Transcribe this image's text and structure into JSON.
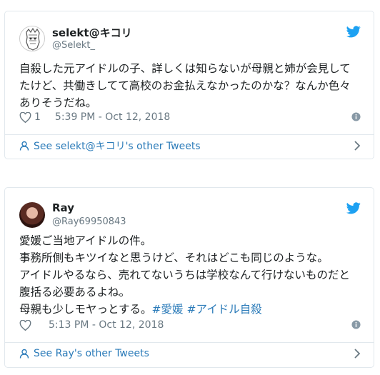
{
  "tweets": [
    {
      "display_name": "selekt@キコリ",
      "handle": "@Selekt_",
      "text": "自殺した元アイドルの子、詳しくは知らないが母親と姉が会見して\nたけど、共働きしてて高校のお金払えなかったのかな？なんか色々\nありそうだね。",
      "like_count": "1",
      "timestamp": "5:39 PM - Oct 12, 2018",
      "other_tweets_link": "See selekt@キコリ's other Tweets",
      "icons": {
        "avatar": "avatar",
        "logo": "twitter-bird-icon",
        "like": "heart-icon",
        "info": "info-icon",
        "profile": "person-icon",
        "chevron": "chevron-right-icon"
      }
    },
    {
      "display_name": "Ray",
      "handle": "@Ray69950843",
      "text": "愛媛ご当地アイドルの件。\n事務所側もキツイなと思うけど、それはどこも同じのような。\nアイドルやるなら、売れてないうちは学校なんて行けないものだと\n腹括る必要あるよね。\n母親も少しモヤっとする。",
      "hashtags": [
        "#愛媛",
        "#アイドル自殺"
      ],
      "like_count": "",
      "timestamp": "5:13 PM - Oct 12, 2018",
      "other_tweets_link": "See Ray's other Tweets",
      "icons": {
        "avatar": "avatar",
        "logo": "twitter-bird-icon",
        "like": "heart-icon",
        "info": "info-icon",
        "profile": "person-icon",
        "chevron": "chevron-right-icon"
      }
    }
  ],
  "colors": {
    "link": "#2b7bb9",
    "twitter_blue": "#1da1f2",
    "muted": "#697882",
    "border": "#e1e8ed"
  }
}
